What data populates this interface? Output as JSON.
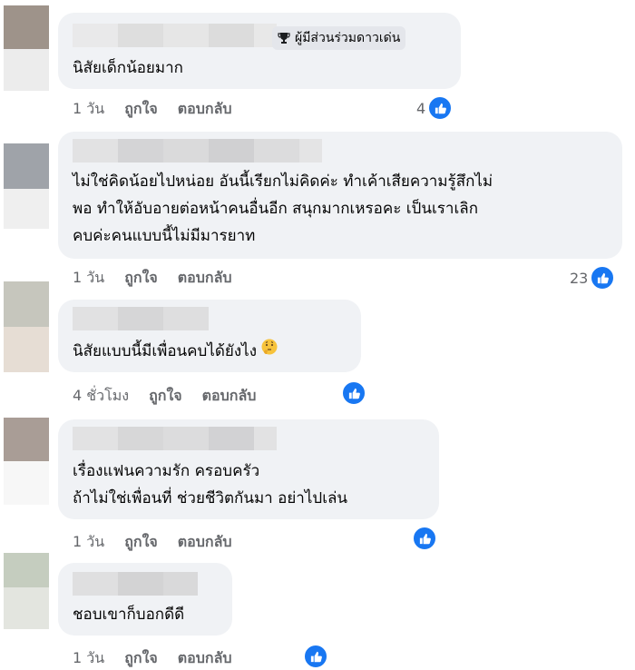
{
  "comments": [
    {
      "badge": "ผู้มีส่วนร่วมดาวเด่น",
      "lines": [
        "นิสัยเด็กน้อยมาก"
      ],
      "time": "1 วัน",
      "like_label": "ถูกใจ",
      "reply_label": "ตอบกลับ",
      "reaction_count": "4"
    },
    {
      "lines": [
        "ไม่ใช่คิดน้อยไปหน่อย อันนี้เรียกไม่คิดค่ะ ทำเค้าเสียความรู้สึกไม่",
        "พอ ทำให้อับอายต่อหน้าคนอื่นอีก สนุกมากเหรอคะ เป็นเราเลิก",
        "คบค่ะคนแบบนี้ไม่มีมารยาท"
      ],
      "time": "1 วัน",
      "like_label": "ถูกใจ",
      "reply_label": "ตอบกลับ",
      "reaction_count": "23"
    },
    {
      "lines": [
        "นิสัยแบบนี้มีเพื่อนคบได้ยังไง"
      ],
      "emoji": "thinking-face",
      "time": "4 ชั่วโมง",
      "like_label": "ถูกใจ",
      "reply_label": "ตอบกลับ",
      "reaction_count": ""
    },
    {
      "lines": [
        "เรื่องแฟนความรัก ครอบครัว",
        "ถ้าไม่ใช่เพื่อนที่ ช่วยชีวิตกันมา อย่าไปเล่น"
      ],
      "time": "1 วัน",
      "like_label": "ถูกใจ",
      "reply_label": "ตอบกลับ",
      "reaction_count": ""
    },
    {
      "lines": [
        "ชอบเขาก็บอกดีดี"
      ],
      "time": "1 วัน",
      "like_label": "ถูกใจ",
      "reply_label": "ตอบกลับ",
      "reaction_count": ""
    }
  ],
  "colors": {
    "bubble": "#f0f2f5",
    "secondary_text": "#65676b",
    "like_blue": "#1877f2"
  },
  "icons": {
    "badge": "trophy-icon",
    "reaction": "thumbs-up-icon"
  }
}
